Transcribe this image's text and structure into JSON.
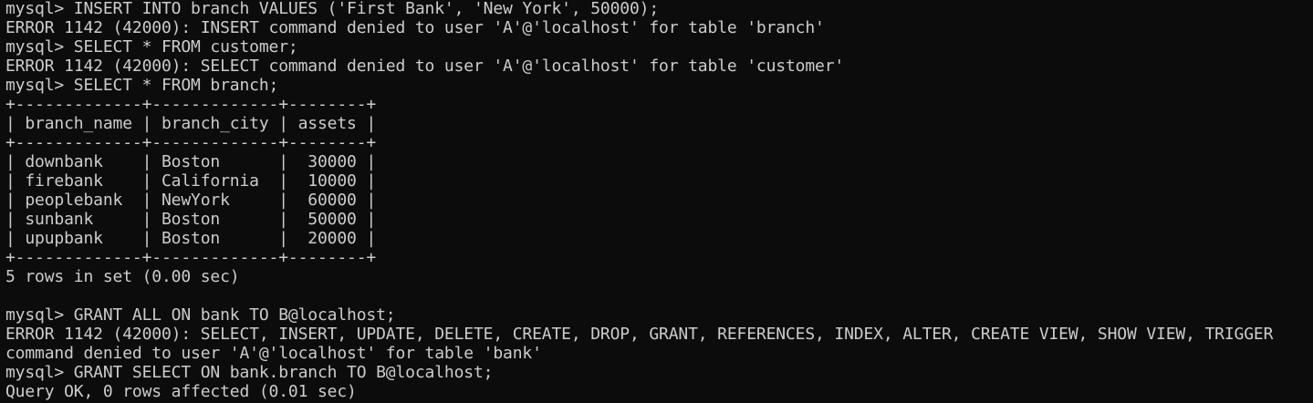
{
  "terminal": {
    "lines": [
      "mysql> INSERT INTO branch VALUES ('First Bank', 'New York', 50000);",
      "ERROR 1142 (42000): INSERT command denied to user 'A'@'localhost' for table 'branch'",
      "mysql> SELECT * FROM customer;",
      "ERROR 1142 (42000): SELECT command denied to user 'A'@'localhost' for table 'customer'",
      "mysql> SELECT * FROM branch;",
      "+-------------+-------------+--------+",
      "| branch_name | branch_city | assets |",
      "+-------------+-------------+--------+",
      "| downbank    | Boston      |  30000 |",
      "| firebank    | California  |  10000 |",
      "| peoplebank  | NewYork     |  60000 |",
      "| sunbank     | Boston      |  50000 |",
      "| upupbank    | Boston      |  20000 |",
      "+-------------+-------------+--------+",
      "5 rows in set (0.00 sec)",
      "",
      "mysql> GRANT ALL ON bank TO B@localhost;",
      "ERROR 1142 (42000): SELECT, INSERT, UPDATE, DELETE, CREATE, DROP, GRANT, REFERENCES, INDEX, ALTER, CREATE VIEW, SHOW VIEW, TRIGGER",
      "command denied to user 'A'@'localhost' for table 'bank'",
      "mysql> GRANT SELECT ON bank.branch TO B@localhost;",
      "Query OK, 0 rows affected (0.01 sec)"
    ]
  }
}
